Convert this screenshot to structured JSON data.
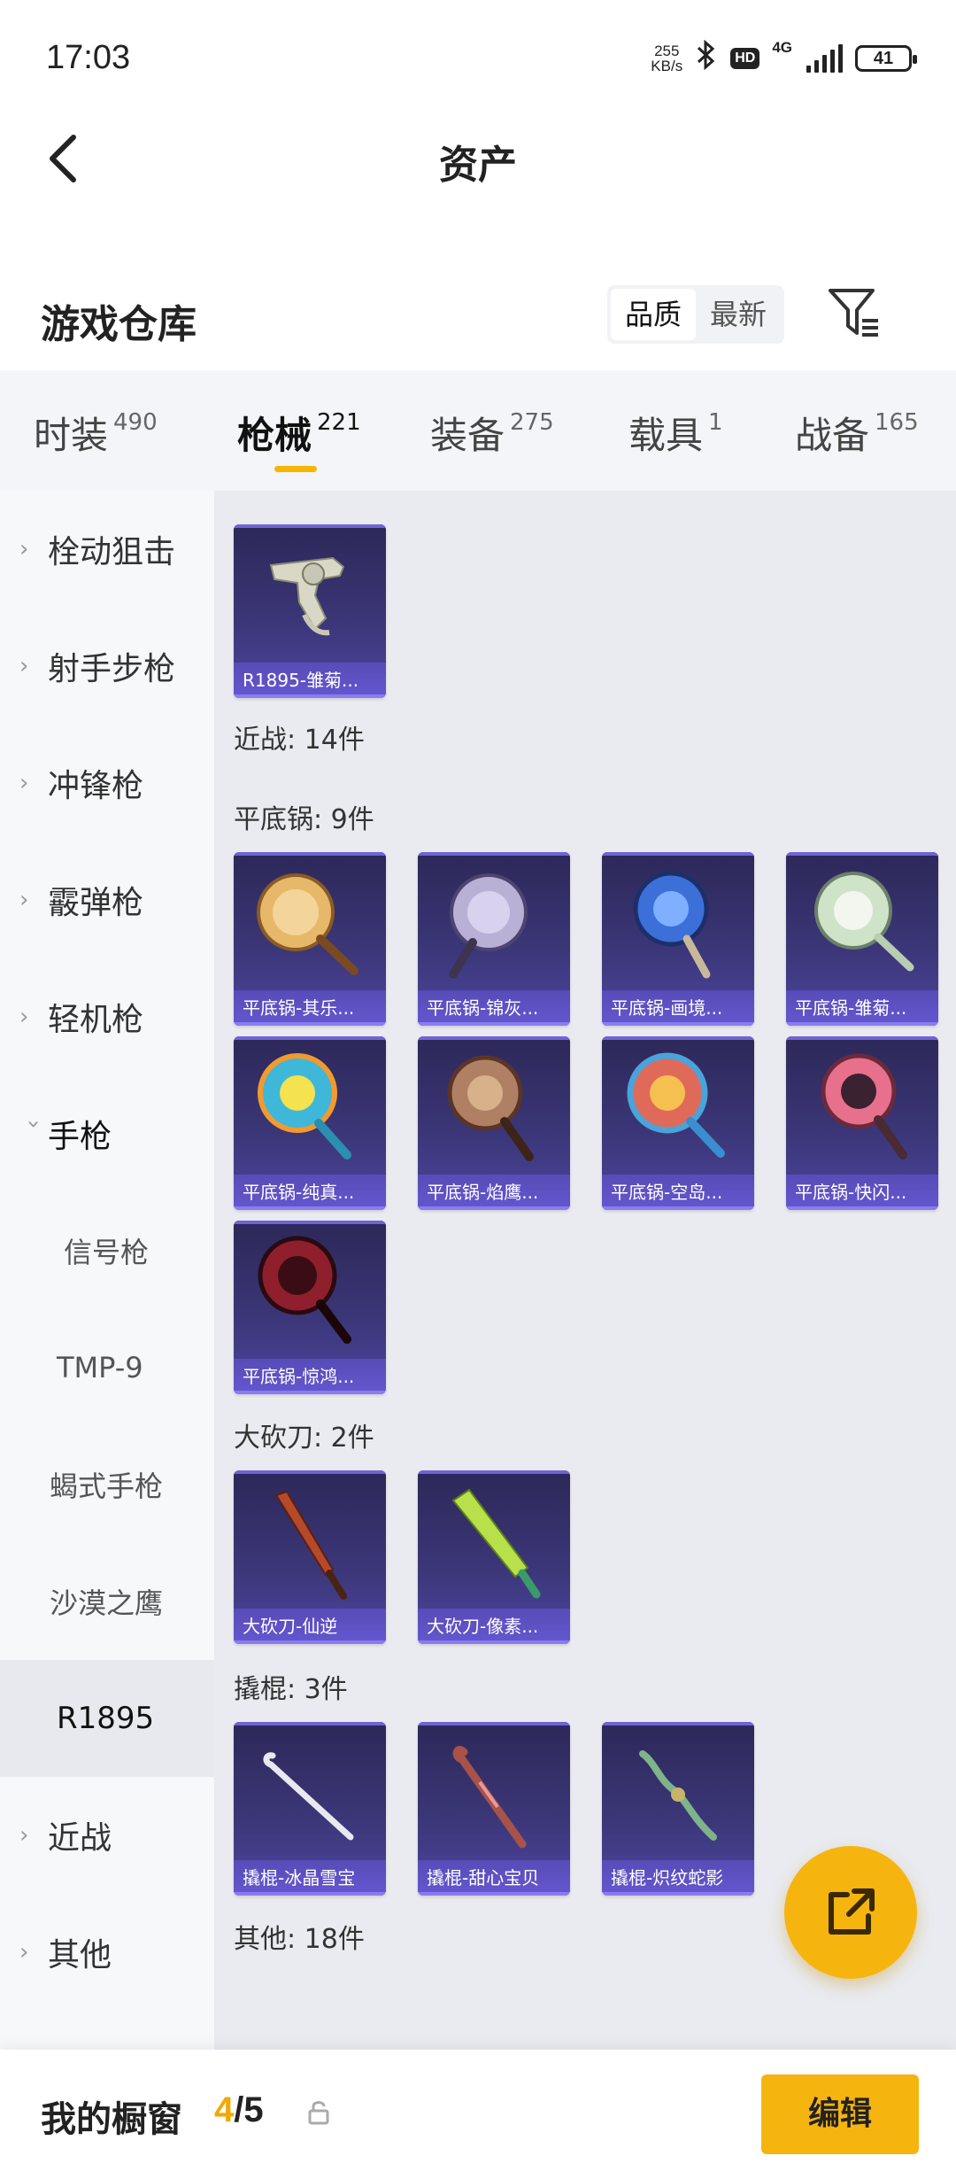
{
  "status_bar": {
    "time": "17:03",
    "net_speed_value": "255",
    "net_speed_unit": "KB/s",
    "bluetooth_icon": "bluetooth-icon",
    "hd_badge": "HD",
    "network_type": "4G",
    "battery": "41"
  },
  "header": {
    "title": "资产",
    "back_icon": "chevron-left-icon"
  },
  "section": {
    "title": "游戏仓库",
    "sort_options": [
      "品质",
      "最新"
    ],
    "sort_selected": "品质",
    "filter_icon": "filter-icon"
  },
  "tabs": [
    {
      "label": "时装",
      "count": "490"
    },
    {
      "label": "枪械",
      "count": "221",
      "active": true
    },
    {
      "label": "装备",
      "count": "275"
    },
    {
      "label": "载具",
      "count": "1"
    },
    {
      "label": "战备",
      "count": "165"
    }
  ],
  "sidebar": [
    {
      "label": "栓动狙击",
      "expandable": true
    },
    {
      "label": "射手步枪",
      "expandable": true
    },
    {
      "label": "冲锋枪",
      "expandable": true
    },
    {
      "label": "霰弹枪",
      "expandable": true
    },
    {
      "label": "轻机枪",
      "expandable": true
    },
    {
      "label": "手枪",
      "expanded": true
    },
    {
      "label": "信号枪",
      "sub": true
    },
    {
      "label": "TMP-9",
      "sub": true
    },
    {
      "label": "蝎式手枪",
      "sub": true
    },
    {
      "label": "沙漠之鹰",
      "sub": true
    },
    {
      "label": "R1895",
      "sub": true,
      "selected": true
    },
    {
      "label": "近战",
      "expandable": true
    },
    {
      "label": "其他",
      "expandable": true
    }
  ],
  "content": {
    "groups": [
      {
        "label": "近战: 14件"
      },
      {
        "label": "平底锅: 9件"
      },
      {
        "label": "大砍刀: 2件"
      },
      {
        "label": "撬棍: 3件"
      },
      {
        "label": "其他: 18件"
      }
    ],
    "items": {
      "pistol": [
        {
          "name": "R1895-雏菊...",
          "icon": "revolver-icon"
        }
      ],
      "pan": [
        {
          "name": "平底锅-其乐...",
          "icon": "pan-icon",
          "color": "#e8b86a"
        },
        {
          "name": "平底锅-锦灰...",
          "icon": "pan-icon",
          "color": "#b9b0d6"
        },
        {
          "name": "平底锅-画境...",
          "icon": "pan-icon",
          "color": "#3d6fd8"
        },
        {
          "name": "平底锅-雏菊...",
          "icon": "pan-icon",
          "color": "#cfe3c8"
        },
        {
          "name": "平底锅-纯真...",
          "icon": "pan-icon",
          "color": "#3fb7d9"
        },
        {
          "name": "平底锅-焰鹰...",
          "icon": "pan-icon",
          "color": "#b08065"
        },
        {
          "name": "平底锅-空岛...",
          "icon": "pan-icon",
          "color": "#e06a5a"
        },
        {
          "name": "平底锅-快闪...",
          "icon": "pan-icon",
          "color": "#e7708d"
        },
        {
          "name": "平底锅-惊鸿...",
          "icon": "pan-icon",
          "color": "#8f1f2c"
        }
      ],
      "machete": [
        {
          "name": "大砍刀-仙逆",
          "icon": "machete-icon",
          "color": "#b54a2a"
        },
        {
          "name": "大砍刀-像素...",
          "icon": "machete-icon",
          "color": "#b8e04a"
        }
      ],
      "crowbar": [
        {
          "name": "撬棍-冰晶雪宝",
          "icon": "crowbar-icon",
          "color": "#e8e8f0"
        },
        {
          "name": "撬棍-甜心宝贝",
          "icon": "crowbar-icon",
          "color": "#a8524a"
        },
        {
          "name": "撬棍-炽纹蛇影",
          "icon": "crowbar-icon",
          "color": "#7fb38a"
        }
      ]
    }
  },
  "fab": {
    "icon": "share-export-icon"
  },
  "bottom_bar": {
    "label": "我的橱窗",
    "count_current": "4",
    "count_total": "/5",
    "lock_icon": "lock-icon",
    "edit_label": "编辑"
  }
}
